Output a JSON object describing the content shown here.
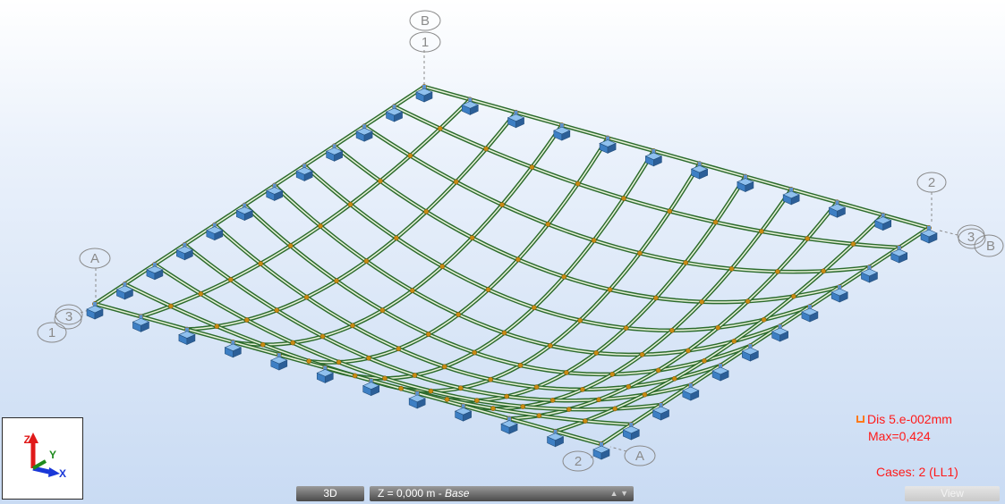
{
  "viewport": {
    "grid_labels": {
      "b_top": "B",
      "one_top": "1",
      "two_right": "2",
      "b_right": "B",
      "three_right": "3",
      "a_left": "A",
      "three_left": "3",
      "one_left": "1",
      "two_bottom": "2",
      "a_bottom": "A"
    }
  },
  "legend": {
    "dis": "Dis  5.e-002mm",
    "max": "Max=0,424",
    "cases": "Cases: 2 (LL1)"
  },
  "axes": {
    "z": "Z",
    "y": "Y",
    "x": "X"
  },
  "bottom_bar": {
    "tab_3d": "3D",
    "level_prefix": "Z = 0,000 m - ",
    "level_name": "Base",
    "view": "View"
  },
  "colors": {
    "member": "#2c6b2c",
    "node": "#c98b12",
    "support": "#3d7fc4",
    "legend_text": "#ff1a1a"
  },
  "icons": [
    "support-icon",
    "axis-triad-icon"
  ]
}
